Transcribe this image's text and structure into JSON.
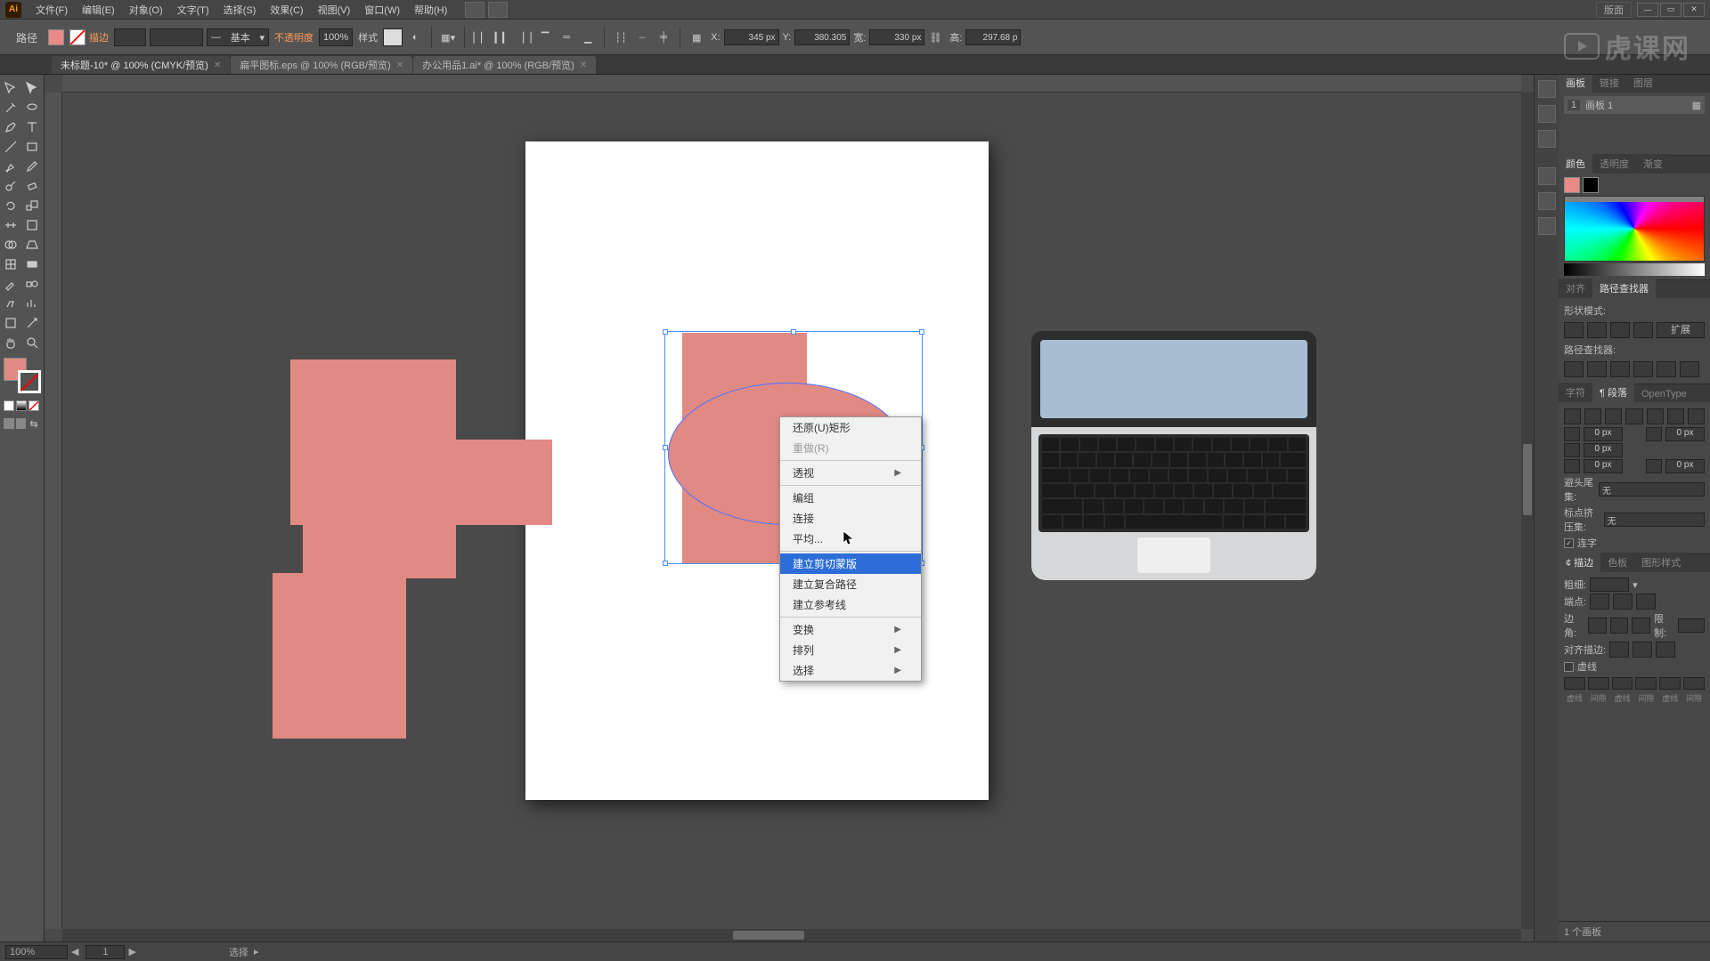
{
  "menu": {
    "items": [
      "文件(F)",
      "编辑(E)",
      "对象(O)",
      "文字(T)",
      "选择(S)",
      "效果(C)",
      "视图(V)",
      "窗口(W)",
      "帮助(H)"
    ],
    "workspace_label": "版面"
  },
  "controlbar": {
    "left_label": "路径",
    "stroke_label": "描边",
    "stroke_value": "",
    "style_group_label": "基本",
    "opacity_label": "不透明度",
    "opacity_value": "100%",
    "style_label": "样式",
    "x_label": "X:",
    "x_value": "345 px",
    "y_label": "Y:",
    "y_value": "380.305",
    "w_label": "宽:",
    "w_value": "330 px",
    "h_label": "高:",
    "h_value": "297.68 p"
  },
  "tabs": [
    {
      "label": "未标题-10* @ 100% (CMYK/预览)",
      "active": true
    },
    {
      "label": "扁平图标.eps @ 100% (RGB/预览)",
      "active": false
    },
    {
      "label": "办公用品1.ai* @ 100% (RGB/预览)",
      "active": false
    }
  ],
  "context_menu": {
    "items": [
      {
        "label": "还原(U)矩形",
        "type": "item"
      },
      {
        "label": "重做(R)",
        "type": "dim"
      },
      {
        "type": "sep"
      },
      {
        "label": "透视",
        "type": "sub"
      },
      {
        "type": "sep"
      },
      {
        "label": "编组",
        "type": "item"
      },
      {
        "label": "连接",
        "type": "item"
      },
      {
        "label": "平均...",
        "type": "item"
      },
      {
        "type": "sep"
      },
      {
        "label": "建立剪切蒙版",
        "type": "hl"
      },
      {
        "label": "建立复合路径",
        "type": "item"
      },
      {
        "label": "建立参考线",
        "type": "item"
      },
      {
        "type": "sep"
      },
      {
        "label": "变换",
        "type": "sub"
      },
      {
        "label": "排列",
        "type": "sub"
      },
      {
        "label": "选择",
        "type": "sub"
      }
    ]
  },
  "panels": {
    "artboards": {
      "tabs": [
        "画板",
        "链接",
        "图层"
      ],
      "row_num": "1",
      "row_label": "画板 1"
    },
    "color": {
      "tabs": [
        "颜色",
        "透明度",
        "渐变"
      ]
    },
    "pathfinder": {
      "tabs": [
        "对齐",
        "路径查找器"
      ],
      "shape_mode_label": "形状模式:",
      "pathfinder_label": "路径查找器:",
      "expand_label": "扩展"
    },
    "character": {
      "tabs": [
        "字符",
        "¶ 段落",
        "OpenType"
      ],
      "kern": "0 px",
      "lead": "0 px",
      "first": "0 px",
      "last": "0 px",
      "hyphen_head_label": "避头尾集:",
      "hyphen_head_value": "无",
      "hyphen_tail_label": "标点挤压集:",
      "hyphen_tail_value": "无",
      "hyphen_checkbox": "连字"
    },
    "stroke": {
      "tabs": [
        "¢ 描边",
        "色板",
        "图形样式"
      ],
      "weight_label": "粗细:",
      "caps_label": "端点:",
      "corner_label": "边角:",
      "limit_label": "限制:",
      "align_label": "对齐描边:",
      "dash_checkbox": "虚线",
      "dash_cols": [
        "虚线",
        "间隙",
        "虚线",
        "间隙",
        "虚线",
        "间隙"
      ]
    },
    "footer": "1 个画板"
  },
  "status": {
    "zoom": "100%",
    "artboard_nav": "1",
    "selection_label": "选择"
  },
  "watermark_text": "虎课网"
}
